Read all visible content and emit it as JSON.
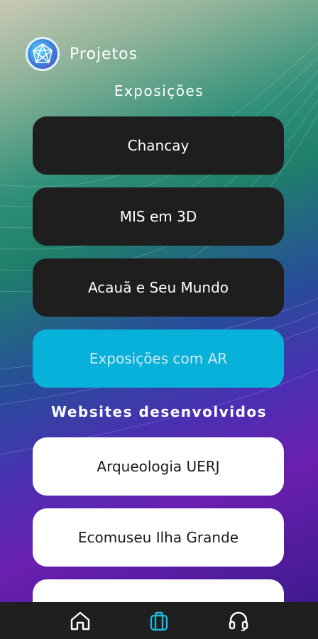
{
  "header": {
    "title": "Projetos"
  },
  "sections": {
    "exhibitions_title": "Exposições",
    "websites_title": "Websites desenvolvidos"
  },
  "exhibitions": [
    {
      "label": "Chancay"
    },
    {
      "label": "MIS em 3D"
    },
    {
      "label": "Acauã e Seu Mundo"
    },
    {
      "label": "Exposições com AR"
    }
  ],
  "websites": [
    {
      "label": "Arqueologia UERJ"
    },
    {
      "label": "Ecomuseu Ilha Grande"
    },
    {
      "label": ""
    }
  ],
  "nav": {
    "items": [
      {
        "icon": "home-icon",
        "active": false
      },
      {
        "icon": "briefcase-icon",
        "active": true
      },
      {
        "icon": "headphones-icon",
        "active": false
      }
    ]
  },
  "colors": {
    "card_dark": "#1e1e1e",
    "card_accent": "#08b1d9",
    "card_light": "#ffffff",
    "nav_active": "#1fb6d9",
    "nav_inactive": "#ffffff"
  }
}
